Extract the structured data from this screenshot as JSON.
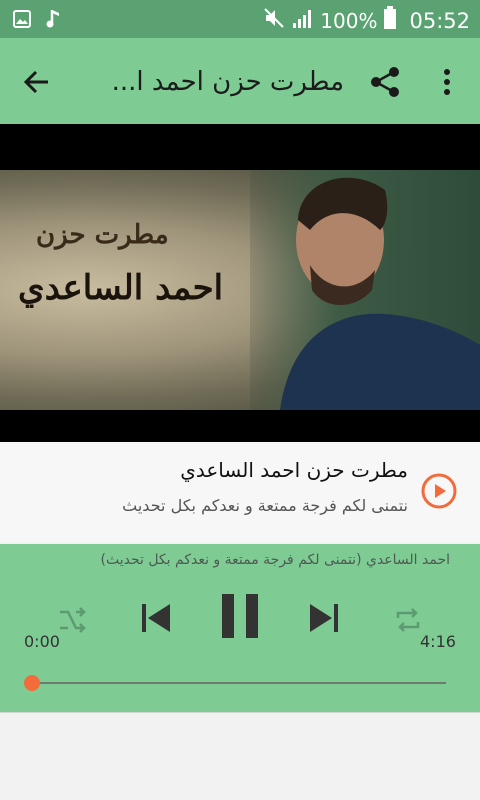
{
  "status_bar": {
    "battery": "100%",
    "time": "05:52",
    "icons": [
      "image-icon",
      "music-note-icon",
      "mute-icon",
      "signal-icon",
      "battery-icon"
    ]
  },
  "app_bar": {
    "title": "مطرت حزن احمد ا...",
    "back_icon": "arrow-left-icon",
    "share_icon": "share-icon",
    "menu_icon": "more-vertical-icon"
  },
  "video": {
    "overlay_line1": "مطرت حزن",
    "overlay_line2": "احمد الساعدي"
  },
  "track": {
    "title": "مطرت حزن احمد الساعدي",
    "subtitle": "نتمنى لكم فرجة ممتعة و نعدكم بكل تحديث",
    "play_icon": "play-circle-icon"
  },
  "player": {
    "now_playing": "احمد الساعدي (نتمنى لكم فرجة ممتعة و نعدكم بكل تحديث)",
    "time_current": "0:00",
    "time_total": "4:16",
    "progress": 0,
    "accent_color": "#f26b3a",
    "bar_color": "#7ecb94"
  }
}
